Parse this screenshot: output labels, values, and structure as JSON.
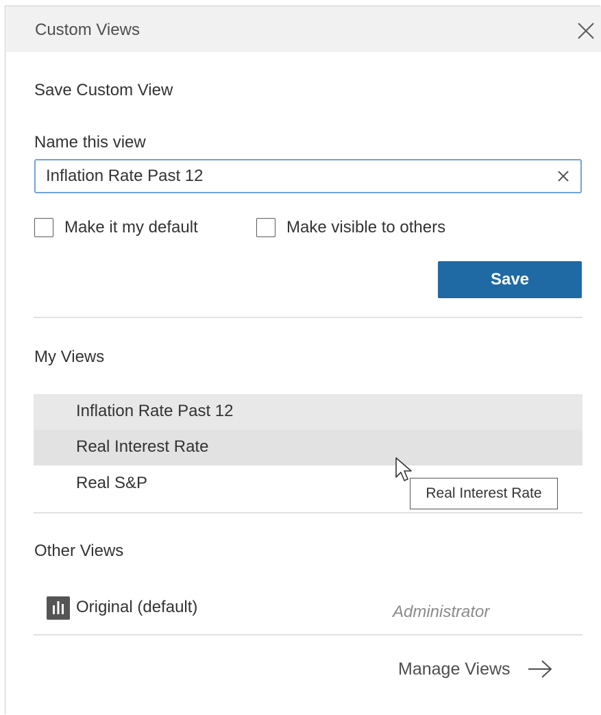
{
  "panel": {
    "title": "Custom Views"
  },
  "save_section": {
    "heading": "Save Custom View",
    "name_label": "Name this view",
    "name_value": "Inflation Rate Past 12",
    "default_checkbox": {
      "label": "Make it my default",
      "checked": false
    },
    "visible_checkbox": {
      "label": "Make visible to others",
      "checked": false
    },
    "save_label": "Save"
  },
  "my_views": {
    "heading": "My Views",
    "items": [
      {
        "label": "Inflation Rate Past 12",
        "state": "selected"
      },
      {
        "label": "Real Interest Rate",
        "state": "hover"
      },
      {
        "label": "Real S&P",
        "state": "normal"
      }
    ],
    "tooltip": "Real Interest Rate"
  },
  "other_views": {
    "heading": "Other Views",
    "items": [
      {
        "label": "Original (default)",
        "owner": "Administrator",
        "icon": "bar-chart-icon"
      }
    ]
  },
  "footer": {
    "manage_label": "Manage Views"
  },
  "colors": {
    "accent": "#1f6aa5",
    "input_focus": "#6fa3d6",
    "header_bg": "#f1f1f1",
    "row_highlight": "#e8e8e8"
  }
}
